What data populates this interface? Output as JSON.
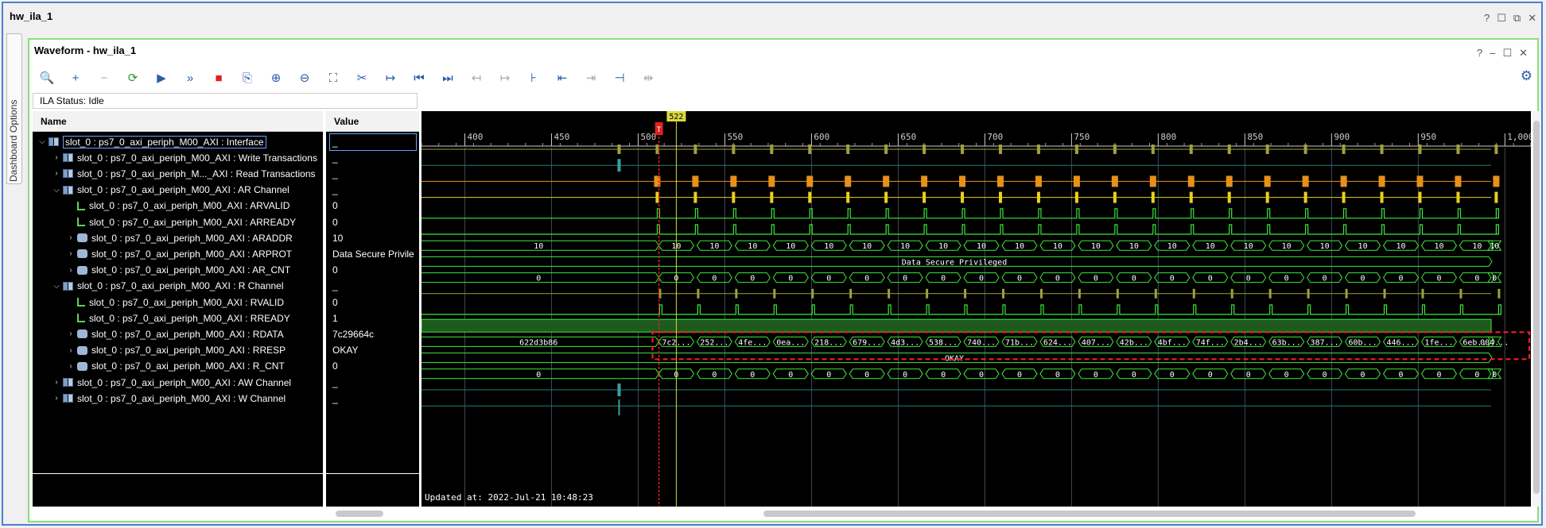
{
  "window": {
    "title": "hw_ila_1"
  },
  "window_controls": [
    "?",
    "☐",
    "⧉",
    "✕"
  ],
  "side_tab": {
    "label": "Dashboard Options"
  },
  "panel": {
    "title": "Waveform - hw_ila_1",
    "controls": [
      "?",
      "–",
      "☐",
      "✕"
    ]
  },
  "toolbar": [
    {
      "icon": "search-icon",
      "glyph": "🔍",
      "enabled": true
    },
    {
      "icon": "add-icon",
      "glyph": "+",
      "enabled": true
    },
    {
      "icon": "remove-icon",
      "glyph": "−",
      "enabled": false
    },
    {
      "icon": "run-trigger-immediate-icon",
      "glyph": "⟳",
      "enabled": true
    },
    {
      "icon": "run-trigger-icon",
      "glyph": "▶",
      "enabled": true
    },
    {
      "icon": "run-continuous-icon",
      "glyph": "»",
      "enabled": true
    },
    {
      "icon": "stop-icon",
      "glyph": "■",
      "enabled": true
    },
    {
      "icon": "export-icon",
      "glyph": "⎘",
      "enabled": true
    },
    {
      "icon": "zoom-in-icon",
      "glyph": "⊕",
      "enabled": true
    },
    {
      "icon": "zoom-out-icon",
      "glyph": "⊖",
      "enabled": true
    },
    {
      "icon": "zoom-fit-icon",
      "glyph": "⛶",
      "enabled": true
    },
    {
      "icon": "zoom-cursor-icon",
      "glyph": "✂",
      "enabled": true
    },
    {
      "icon": "go-to-cursor-icon",
      "glyph": "↦",
      "enabled": true
    },
    {
      "icon": "go-to-start-icon",
      "glyph": "⏮",
      "enabled": true
    },
    {
      "icon": "go-to-end-icon",
      "glyph": "⏭",
      "enabled": true
    },
    {
      "icon": "previous-transition-icon",
      "glyph": "↤",
      "enabled": false
    },
    {
      "icon": "next-transition-icon",
      "glyph": "↦",
      "enabled": false
    },
    {
      "icon": "add-marker-icon",
      "glyph": "⊦",
      "enabled": true
    },
    {
      "icon": "previous-marker-icon",
      "glyph": "⇤",
      "enabled": true
    },
    {
      "icon": "next-marker-icon",
      "glyph": "⇥",
      "enabled": false
    },
    {
      "icon": "delete-marker-icon",
      "glyph": "⊣",
      "enabled": true
    },
    {
      "icon": "swap-cursors-icon",
      "glyph": "⇹",
      "enabled": false
    }
  ],
  "ila_status": "ILA Status: Idle",
  "columns": {
    "name": "Name",
    "value": "Value"
  },
  "signals": [
    {
      "indent": 0,
      "expander": "v",
      "icon": "bus",
      "name": "slot_0 : ps7_0_axi_periph_M00_AXI : Interface",
      "value": "_",
      "selected": true
    },
    {
      "indent": 1,
      "expander": ">",
      "icon": "bus",
      "name": "slot_0 : ps7_0_axi_periph_M00_AXI : Write Transactions",
      "value": "_"
    },
    {
      "indent": 1,
      "expander": ">",
      "icon": "bus",
      "name": "slot_0 : ps7_0_axi_periph_M..._AXI : Read Transactions",
      "value": "_"
    },
    {
      "indent": 1,
      "expander": "v",
      "icon": "bus",
      "name": "slot_0 : ps7_0_axi_periph_M00_AXI : AR Channel",
      "value": "_"
    },
    {
      "indent": 2,
      "expander": "",
      "icon": "bit",
      "name": "slot_0 : ps7_0_axi_periph_M00_AXI : ARVALID",
      "value": "0"
    },
    {
      "indent": 2,
      "expander": "",
      "icon": "bit",
      "name": "slot_0 : ps7_0_axi_periph_M00_AXI : ARREADY",
      "value": "0"
    },
    {
      "indent": 2,
      "expander": ">",
      "icon": "vec",
      "name": "slot_0 : ps7_0_axi_periph_M00_AXI : ARADDR",
      "value": "10"
    },
    {
      "indent": 2,
      "expander": ">",
      "icon": "vec",
      "name": "slot_0 : ps7_0_axi_periph_M00_AXI : ARPROT",
      "value": "Data Secure Privile"
    },
    {
      "indent": 2,
      "expander": ">",
      "icon": "vec",
      "name": "slot_0 : ps7_0_axi_periph_M00_AXI : AR_CNT",
      "value": "0"
    },
    {
      "indent": 1,
      "expander": "v",
      "icon": "bus",
      "name": "slot_0 : ps7_0_axi_periph_M00_AXI : R Channel",
      "value": "_"
    },
    {
      "indent": 2,
      "expander": "",
      "icon": "bit",
      "name": "slot_0 : ps7_0_axi_periph_M00_AXI : RVALID",
      "value": "0"
    },
    {
      "indent": 2,
      "expander": "",
      "icon": "bit",
      "name": "slot_0 : ps7_0_axi_periph_M00_AXI : RREADY",
      "value": "1"
    },
    {
      "indent": 2,
      "expander": ">",
      "icon": "vec",
      "name": "slot_0 : ps7_0_axi_periph_M00_AXI : RDATA",
      "value": "7c29664c"
    },
    {
      "indent": 2,
      "expander": ">",
      "icon": "vec",
      "name": "slot_0 : ps7_0_axi_periph_M00_AXI : RRESP",
      "value": "OKAY"
    },
    {
      "indent": 2,
      "expander": ">",
      "icon": "vec",
      "name": "slot_0 : ps7_0_axi_periph_M00_AXI : R_CNT",
      "value": "0"
    },
    {
      "indent": 1,
      "expander": ">",
      "icon": "bus",
      "name": "slot_0 : ps7_0_axi_periph_M00_AXI : AW Channel",
      "value": "_"
    },
    {
      "indent": 1,
      "expander": ">",
      "icon": "bus",
      "name": "slot_0 : ps7_0_axi_periph_M00_AXI : W Channel",
      "value": "_"
    }
  ],
  "waveform": {
    "ruler_ticks": [
      "400",
      "450",
      "500",
      "550",
      "600",
      "650",
      "700",
      "750",
      "800",
      "850",
      "900",
      "950",
      "1,000"
    ],
    "ruler_range": [
      375,
      1015
    ],
    "cursor_sample": 522,
    "cursor_label": "522",
    "trigger_sample": 512,
    "trigger_label": "T",
    "updated_at": "Updated at: 2022-Jul-21 10:48:23",
    "araddr_pre": "10",
    "araddr_values": [
      "10",
      "10",
      "10",
      "10",
      "10",
      "10",
      "10",
      "10",
      "10",
      "10",
      "10",
      "10",
      "10",
      "10",
      "10",
      "10",
      "10",
      "10",
      "10",
      "10",
      "10",
      "10",
      "10"
    ],
    "arprot_value": "Data Secure Privileged",
    "cnt_pre": "0",
    "cnt_values": [
      "0",
      "0",
      "0",
      "0",
      "0",
      "0",
      "0",
      "0",
      "0",
      "0",
      "0",
      "0",
      "0",
      "0",
      "0",
      "0",
      "0",
      "0",
      "0",
      "0",
      "0",
      "0",
      "0"
    ],
    "rdata_pre": "622d3b86",
    "rdata_values": [
      "7c2...",
      "252...",
      "4fe...",
      "0ea...",
      "218...",
      "679...",
      "4d3...",
      "538...",
      "740...",
      "71b...",
      "624...",
      "407...",
      "42b...",
      "4bf...",
      "74f...",
      "2b4...",
      "63b...",
      "387...",
      "60b...",
      "446...",
      "1fe...",
      "6eb...",
      "004..."
    ],
    "rresp_value": "OKAY",
    "colors": {
      "green": "#3ee83e",
      "olive": "#a0a040",
      "orange": "#e8901a",
      "yellow": "#e8d020",
      "trigger": "#e02020",
      "cursor": "#d8d840",
      "highlight": "#ff2020"
    }
  }
}
